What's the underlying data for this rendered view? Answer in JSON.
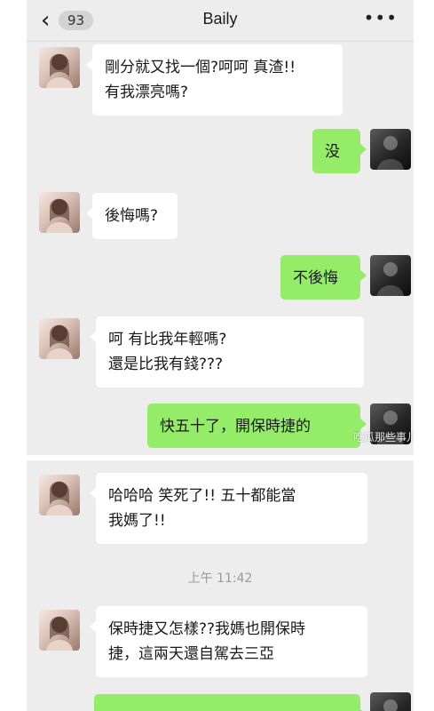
{
  "header": {
    "back_icon": "chevron-left-icon",
    "unread_count": "93",
    "title": "Baily",
    "more_icon": "more-dots-icon"
  },
  "messages": [
    {
      "side": "left",
      "lines": [
        "剛分就又找一個?呵呵 真渣!!",
        "有我漂亮嗎?"
      ]
    },
    {
      "side": "right",
      "lines": [
        "没"
      ]
    },
    {
      "side": "left",
      "lines": [
        "後悔嗎?"
      ]
    },
    {
      "side": "right",
      "lines": [
        "不後悔"
      ]
    },
    {
      "side": "left",
      "lines": [
        "呵 有比我年輕嗎?",
        "還是比我有錢???"
      ]
    },
    {
      "side": "right",
      "lines": [
        "快五十了，開保時捷的"
      ]
    },
    {
      "side": "left",
      "lines": [
        "哈哈哈  笑死了!! 五十都能當",
        "我媽了!!"
      ]
    },
    {
      "side": "left",
      "lines": [
        "保時捷又怎樣??我媽也開保時",
        "捷，這兩天還自駕去三亞"
      ]
    }
  ],
  "timestamp": "上午 11:42",
  "watermark": "吃瓜那些事儿",
  "colors": {
    "chat_background": "#ededed",
    "incoming_bubble": "#ffffff",
    "outgoing_bubble": "#95ec69"
  }
}
